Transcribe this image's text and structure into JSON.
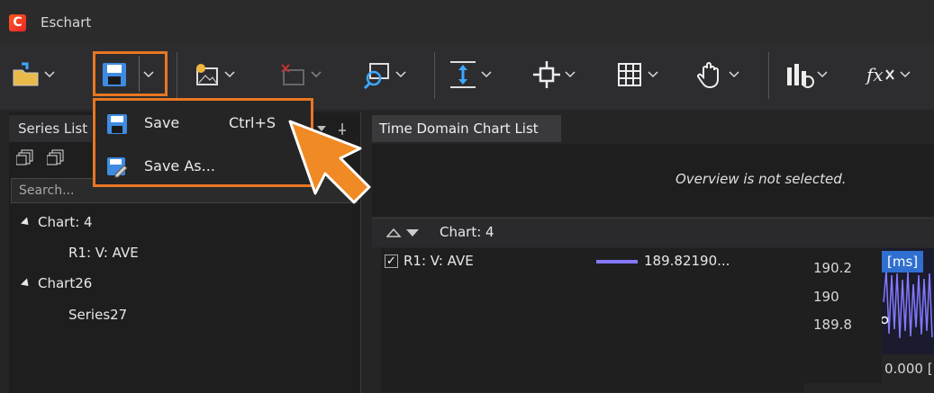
{
  "window": {
    "title": "Eschart"
  },
  "toolbar": {
    "buttons": [
      "open-icon",
      "save-icon",
      "export-image-icon",
      "delete-image-icon",
      "zoom-image-icon",
      "fit-vertical-icon",
      "move-cross-icon",
      "grid-icon",
      "pan-hand-icon",
      "chart-settings-icon",
      "function-icon"
    ]
  },
  "save_menu": {
    "items": [
      {
        "label": "Save",
        "shortcut": "Ctrl+S"
      },
      {
        "label": "Save As...",
        "shortcut": ""
      }
    ]
  },
  "series_panel": {
    "tab_title": "Series List",
    "search_placeholder": "Search...",
    "tree": [
      {
        "label": "Chart: 4",
        "children": [
          "R1: V: AVE"
        ]
      },
      {
        "label": "Chart26",
        "children": [
          "Series27"
        ]
      }
    ]
  },
  "chart_panel": {
    "tab_title": "Time Domain Chart List",
    "overview_message": "Overview is not selected.",
    "chart_title": "Chart: 4",
    "series_name": "R1: V: AVE",
    "series_checked": true,
    "series_value": "189.82190...",
    "y_ticks": [
      "190.2",
      "190",
      "189.8"
    ],
    "x_start": "0.000 [",
    "unit_badge": "[ms]",
    "series_color": "#8479ff"
  },
  "colors": {
    "highlight": "#e87722",
    "accent": "#2f6fd0"
  }
}
